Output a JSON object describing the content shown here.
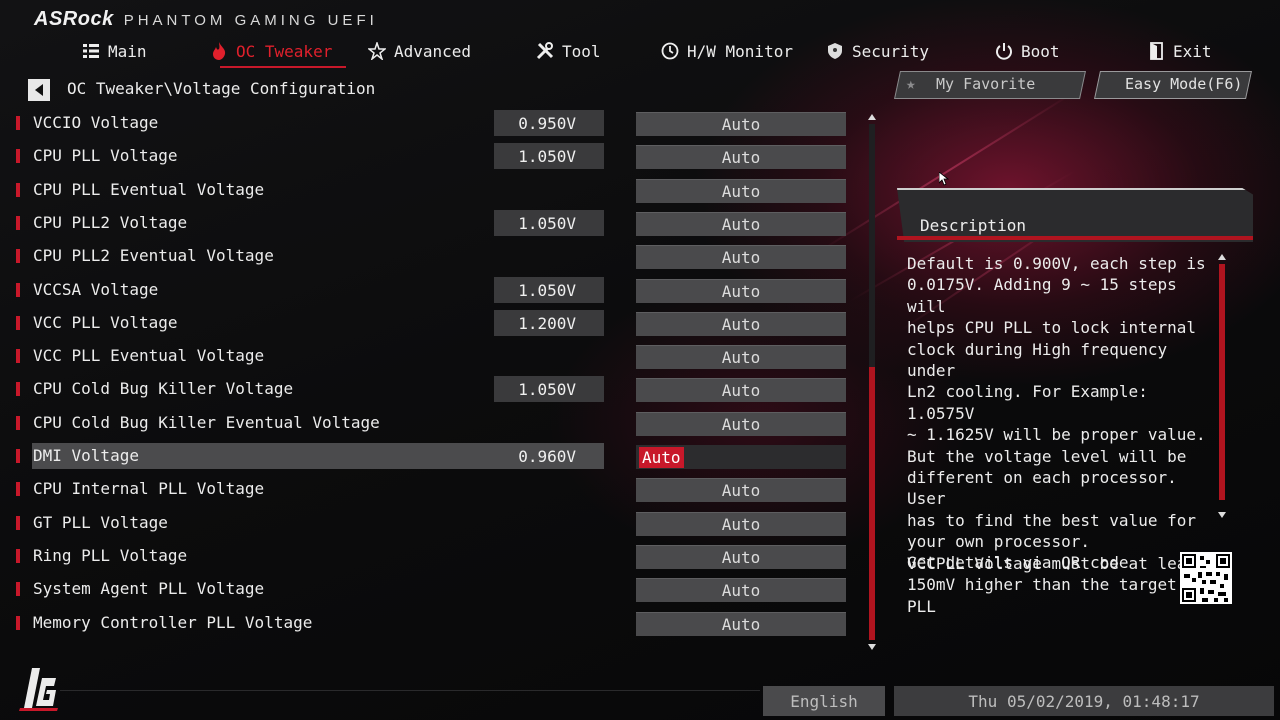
{
  "header": {
    "brand": "ASRock",
    "subtitle": "PHANTOM GAMING UEFI"
  },
  "nav": [
    {
      "label": "Main",
      "icon": "list-icon",
      "active": false
    },
    {
      "label": "OC Tweaker",
      "icon": "flame-icon",
      "active": true
    },
    {
      "label": "Advanced",
      "icon": "star-icon",
      "active": false
    },
    {
      "label": "Tool",
      "icon": "tools-icon",
      "active": false
    },
    {
      "label": "H/W Monitor",
      "icon": "monitor-icon",
      "active": false
    },
    {
      "label": "Security",
      "icon": "shield-icon",
      "active": false
    },
    {
      "label": "Boot",
      "icon": "power-icon",
      "active": false
    },
    {
      "label": "Exit",
      "icon": "exit-icon",
      "active": false
    }
  ],
  "breadcrumb": "OC Tweaker\\Voltage Configuration",
  "settings": [
    {
      "label": "VCCIO Voltage",
      "current": "0.950V",
      "option": "Auto"
    },
    {
      "label": "CPU PLL Voltage",
      "current": "1.050V",
      "option": "Auto"
    },
    {
      "label": "CPU PLL Eventual Voltage",
      "current": "",
      "option": "Auto"
    },
    {
      "label": "CPU PLL2 Voltage",
      "current": "1.050V",
      "option": "Auto"
    },
    {
      "label": "CPU PLL2 Eventual Voltage",
      "current": "",
      "option": "Auto"
    },
    {
      "label": "VCCSA Voltage",
      "current": "1.050V",
      "option": "Auto"
    },
    {
      "label": "VCC PLL Voltage",
      "current": "1.200V",
      "option": "Auto"
    },
    {
      "label": "VCC PLL Eventual Voltage",
      "current": "",
      "option": "Auto"
    },
    {
      "label": "CPU Cold Bug Killer Voltage",
      "current": "1.050V",
      "option": "Auto"
    },
    {
      "label": "CPU Cold Bug Killer Eventual Voltage",
      "current": "",
      "option": "Auto"
    },
    {
      "label": "DMI Voltage",
      "current": "0.960V",
      "option": "Auto",
      "selected": true
    },
    {
      "label": "CPU Internal PLL Voltage",
      "current": "",
      "option": "Auto"
    },
    {
      "label": "GT PLL Voltage",
      "current": "",
      "option": "Auto"
    },
    {
      "label": "Ring PLL Voltage",
      "current": "",
      "option": "Auto"
    },
    {
      "label": "System Agent PLL Voltage",
      "current": "",
      "option": "Auto"
    },
    {
      "label": "Memory Controller PLL Voltage",
      "current": "",
      "option": "Auto"
    }
  ],
  "right": {
    "favorite_label": "My Favorite",
    "easy_mode_label": "Easy Mode(F6)",
    "description_title": "Description",
    "description_text": "Default is 0.900V, each step is\n0.0175V. Adding 9 ~ 15 steps will\nhelps CPU PLL to lock internal\nclock during High frequency under\nLn2 cooling. For Example: 1.0575V\n~ 1.1625V will be proper value.\nBut the voltage level will be\ndifferent on each processor. User\nhas to find the best value for\nyour own processor.\nVCCPLL Voltage must be at least\n150mV higher than the target PLL",
    "qr_text": "Get details via QR code"
  },
  "footer": {
    "language": "English",
    "datetime": "Thu 05/02/2019, 01:48:17"
  },
  "colors": {
    "accent": "#c8182a",
    "row_value_bg": "#3a3a3c",
    "option_bg": "#4a4a4c"
  }
}
